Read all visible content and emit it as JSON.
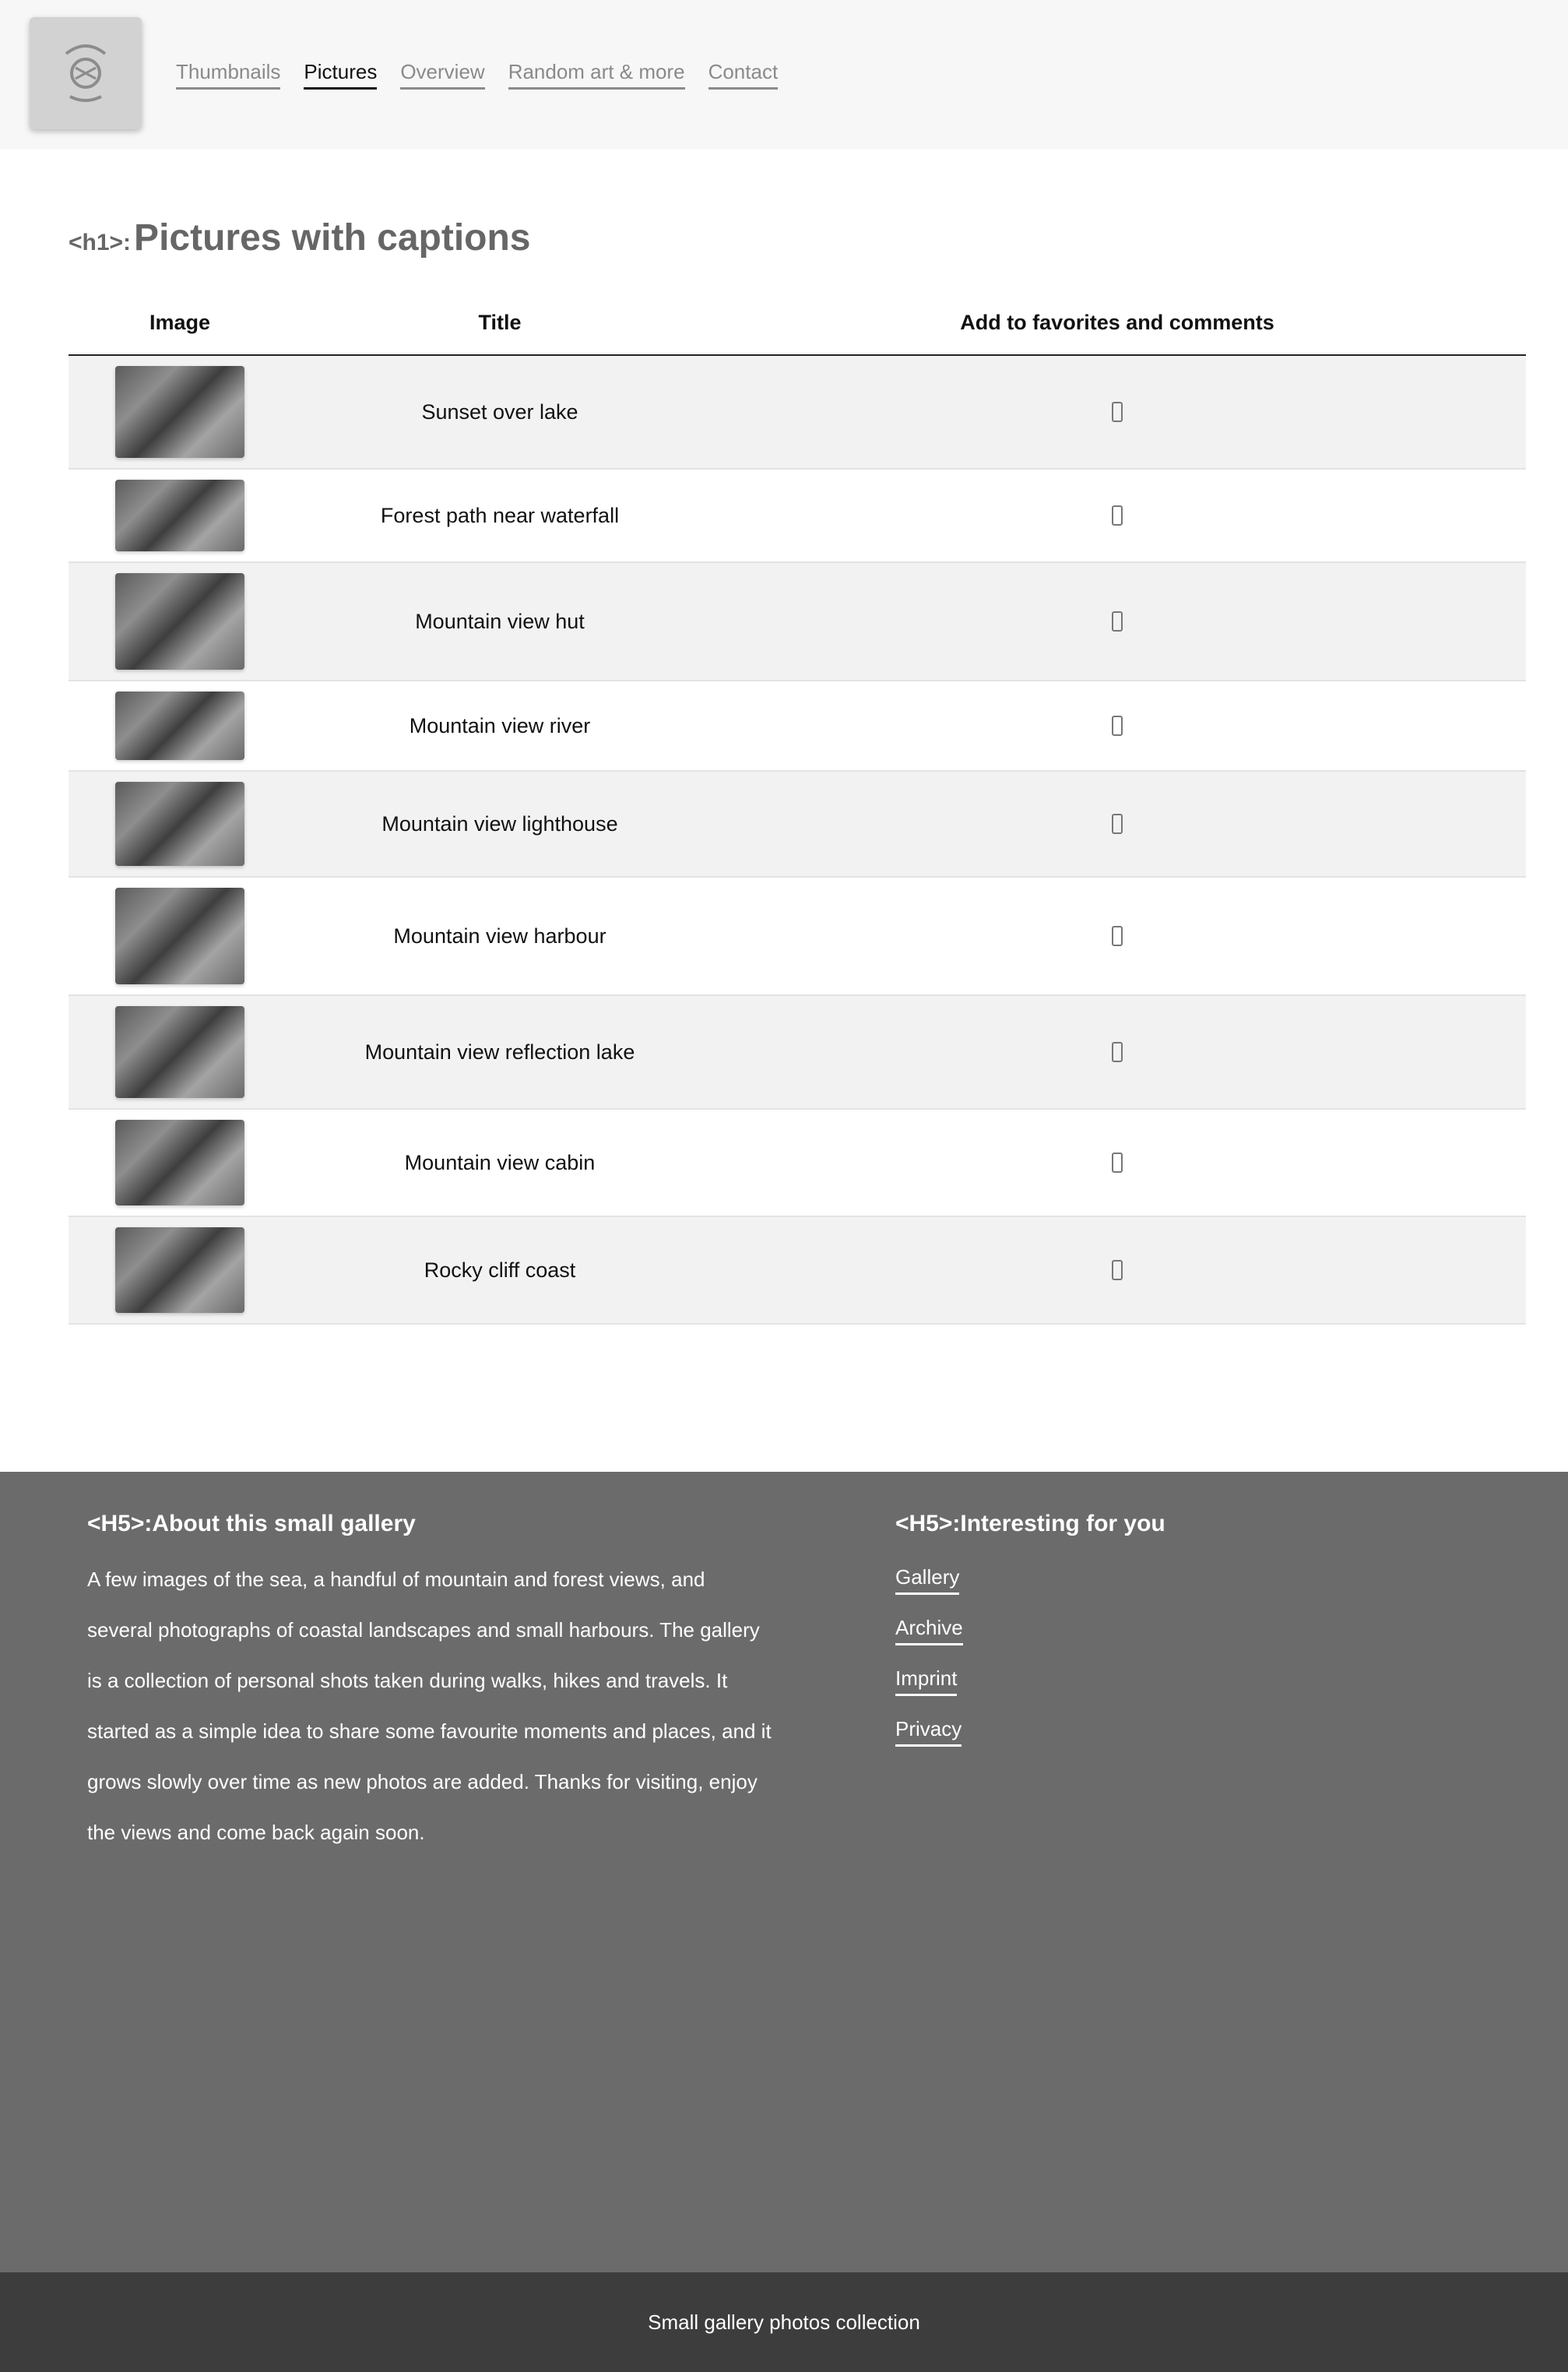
{
  "header": {
    "logo_icon": "crest-logo-icon",
    "nav": [
      {
        "label": "Thumbnails",
        "active": false
      },
      {
        "label": "Pictures",
        "active": true
      },
      {
        "label": "Overview",
        "active": false
      },
      {
        "label": "Random art & more",
        "active": false
      },
      {
        "label": "Contact",
        "active": false
      }
    ]
  },
  "main": {
    "heading_tag": "<h1>:",
    "heading": "Pictures with captions",
    "table": {
      "headers": [
        "Image",
        "Title",
        "Add to favorites and comments"
      ],
      "rows": [
        {
          "title": "Sunset over lake",
          "thumb_height": 118
        },
        {
          "title": "Forest path near waterfall",
          "thumb_height": 92
        },
        {
          "title": "Mountain view hut",
          "thumb_height": 124
        },
        {
          "title": "Mountain view river",
          "thumb_height": 88
        },
        {
          "title": "Mountain view lighthouse",
          "thumb_height": 108
        },
        {
          "title": "Mountain view harbour",
          "thumb_height": 124
        },
        {
          "title": "Mountain view reflection lake",
          "thumb_height": 118
        },
        {
          "title": "Mountain view cabin",
          "thumb_height": 110
        },
        {
          "title": "Rocky cliff coast",
          "thumb_height": 110
        }
      ],
      "select_icon": "favorite-toggle-icon"
    }
  },
  "footer": {
    "about": {
      "tag": "<H5>:",
      "heading": "About this small gallery",
      "text": "A few images of the sea, a handful of mountain and forest views, and several photographs of coastal landscapes and small harbours. The gallery is a collection of personal shots taken during walks, hikes and travels. It started as a simple idea to share some favourite moments and places, and it grows slowly over time as new photos are added. Thanks for visiting, enjoy the views and come back again soon."
    },
    "links": {
      "tag": "<H5>:",
      "heading": "Interesting for you",
      "items": [
        "Gallery",
        "Archive",
        "Imprint",
        "Privacy"
      ]
    }
  },
  "bottom_bar": {
    "text": "Small gallery photos collection"
  }
}
